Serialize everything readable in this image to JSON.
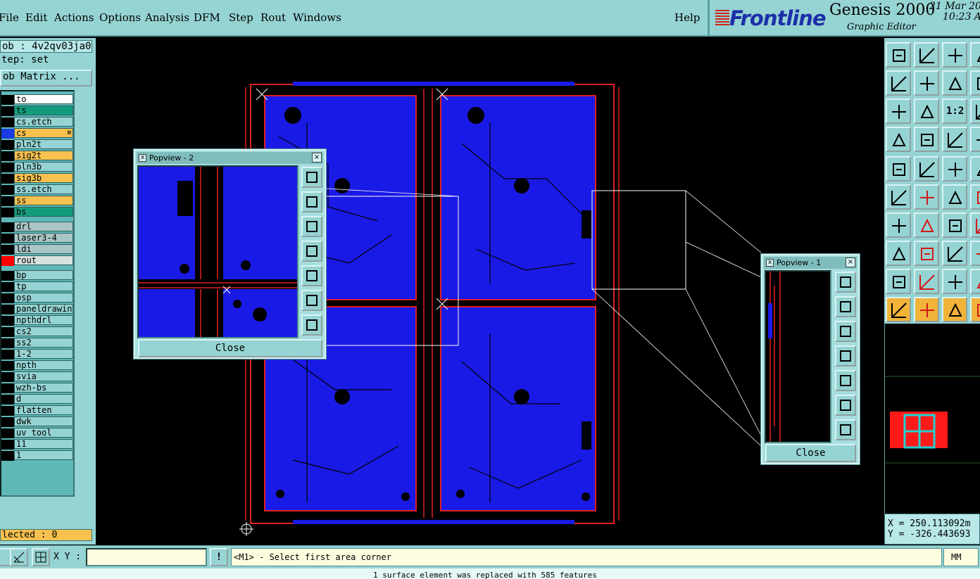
{
  "menu": {
    "items": [
      "File",
      "Edit",
      "Actions",
      "Options",
      "Analysis",
      "DFM",
      "Step",
      "Rout",
      "Windows"
    ],
    "help": "Help"
  },
  "brand": {
    "logo": "Frontline",
    "product": "Genesis 2000",
    "subtitle": "Graphic Editor",
    "date": "21 Mar 20",
    "time": "10:23 A"
  },
  "left_panel": {
    "job": "ob : 4v2qv03ja0",
    "step": "tep: set",
    "matrix_button": "ob Matrix ...",
    "layers": [
      {
        "name": "to",
        "color": "#ffffff",
        "swatch": "#000000"
      },
      {
        "name": "ts",
        "color": "#139c7c",
        "swatch": "#000000"
      },
      {
        "name": "cs.etch",
        "color": "#96d3d3",
        "swatch": "#000000"
      },
      {
        "name": "cs",
        "color": "#f7c14f",
        "swatch": "#1a3be0",
        "flag": "⊠"
      },
      {
        "name": "pln2t",
        "color": "#96d3d3",
        "swatch": "#000000"
      },
      {
        "name": "sig2t",
        "color": "#f7c14f",
        "swatch": "#000000"
      },
      {
        "name": "pln3b",
        "color": "#96d3d3",
        "swatch": "#000000"
      },
      {
        "name": "sig3b",
        "color": "#f7c14f",
        "swatch": "#000000"
      },
      {
        "name": "ss.etch",
        "color": "#96d3d3",
        "swatch": "#000000"
      },
      {
        "name": "ss",
        "color": "#f7c14f",
        "swatch": "#000000"
      },
      {
        "name": "bs",
        "color": "#139c7c",
        "swatch": "#000000"
      },
      {
        "name": "drl",
        "color": "#aac5c5",
        "swatch": "#000000"
      },
      {
        "name": "laser3-4",
        "color": "#aac5c5",
        "swatch": "#000000"
      },
      {
        "name": "ldi",
        "color": "#aac5c5",
        "swatch": "#000000"
      },
      {
        "name": "rout",
        "color": "#d8e0e0",
        "swatch": "#ff0000"
      },
      {
        "name": "bp",
        "color": "#96d3d3",
        "swatch": "#000000"
      },
      {
        "name": "tp",
        "color": "#96d3d3",
        "swatch": "#000000"
      },
      {
        "name": "osp",
        "color": "#96d3d3",
        "swatch": "#000000"
      },
      {
        "name": "paneldrawing",
        "color": "#96d3d3",
        "swatch": "#000000"
      },
      {
        "name": "npthdrl",
        "color": "#96d3d3",
        "swatch": "#000000"
      },
      {
        "name": "cs2",
        "color": "#96d3d3",
        "swatch": "#000000"
      },
      {
        "name": "ss2",
        "color": "#96d3d3",
        "swatch": "#000000"
      },
      {
        "name": "1-2",
        "color": "#96d3d3",
        "swatch": "#000000"
      },
      {
        "name": "npth",
        "color": "#96d3d3",
        "swatch": "#000000"
      },
      {
        "name": "svia",
        "color": "#96d3d3",
        "swatch": "#000000"
      },
      {
        "name": "wzh-bs",
        "color": "#96d3d3",
        "swatch": "#000000"
      },
      {
        "name": "d",
        "color": "#96d3d3",
        "swatch": "#000000"
      },
      {
        "name": "flatten",
        "color": "#96d3d3",
        "swatch": "#000000"
      },
      {
        "name": "dwk",
        "color": "#96d3d3",
        "swatch": "#000000"
      },
      {
        "name": "uv_tool",
        "color": "#96d3d3",
        "swatch": "#000000"
      },
      {
        "name": "11",
        "color": "#96d3d3",
        "swatch": "#000000"
      },
      {
        "name": "1",
        "color": "#96d3d3",
        "swatch": "#000000"
      }
    ],
    "selected": "lected : 0"
  },
  "popview2": {
    "title": "Popview - 2",
    "close": "Close"
  },
  "popview1": {
    "title": "Popview - 1",
    "close": "Close"
  },
  "toolbox": {
    "ratio_label": "1:2"
  },
  "coords": {
    "x": "X = 250.113092m",
    "y": "Y = -326.443693"
  },
  "bottom": {
    "xy_label": "X Y :",
    "xy_value": "",
    "info": "!",
    "prompt": "<M1> - Select first area corner",
    "units": "MM",
    "status": "1 surface element was replaced with 585 features"
  },
  "colors": {
    "panel": "#96d3d3",
    "copper": "#1a1ae6",
    "rout": "#e02020"
  }
}
